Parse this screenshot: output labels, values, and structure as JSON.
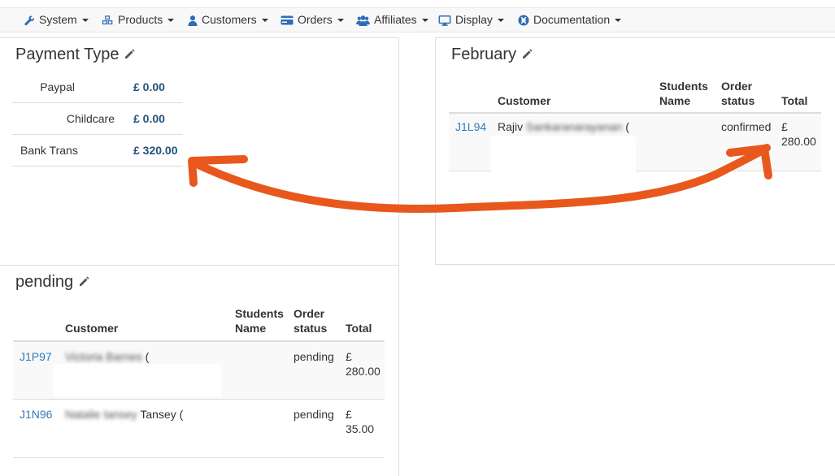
{
  "nav": {
    "items": [
      {
        "label": "System",
        "icon": "wrench-icon"
      },
      {
        "label": "Products",
        "icon": "cubes-icon"
      },
      {
        "label": "Customers",
        "icon": "user-icon"
      },
      {
        "label": "Orders",
        "icon": "credit-card-icon"
      },
      {
        "label": "Affiliates",
        "icon": "users-icon"
      },
      {
        "label": "Display",
        "icon": "desktop-icon"
      },
      {
        "label": "Documentation",
        "icon": "life-ring-icon"
      }
    ]
  },
  "payment_panel": {
    "title": "Payment Type",
    "rows": [
      {
        "label": "Paypal",
        "value": "£ 0.00"
      },
      {
        "label": "Childcare",
        "value": "£ 0.00"
      },
      {
        "label": "Bank Trans",
        "value": "£ 320.00"
      }
    ]
  },
  "february_panel": {
    "title": "February",
    "headers": {
      "customer": "Customer",
      "students": "Students Name",
      "status": "Order status",
      "total": "Total"
    },
    "rows": [
      {
        "id": "J1L94",
        "customer_visible": "Rajiv",
        "customer_blurred": "Sankaranarayanan",
        "customer_suffix": "(",
        "status": "confirmed",
        "total_symbol": "£",
        "total_value": "280.00"
      }
    ]
  },
  "pending_panel": {
    "title": "pending",
    "headers": {
      "customer": "Customer",
      "students": "Students Name",
      "status": "Order status",
      "total": "Total"
    },
    "rows": [
      {
        "id": "J1P97",
        "customer_blurred": "Victoria Barnes",
        "customer_suffix": "(",
        "status": "pending",
        "total_symbol": "£",
        "total_value": "280.00"
      },
      {
        "id": "J1N96",
        "customer_blurred": "Natalie tansey",
        "customer_suffix": "Tansey (",
        "status": "pending",
        "total_symbol": "£",
        "total_value": "35.00"
      }
    ]
  },
  "colors": {
    "arrow": "#e8581c",
    "link": "#337ab7",
    "value": "#23527c"
  }
}
